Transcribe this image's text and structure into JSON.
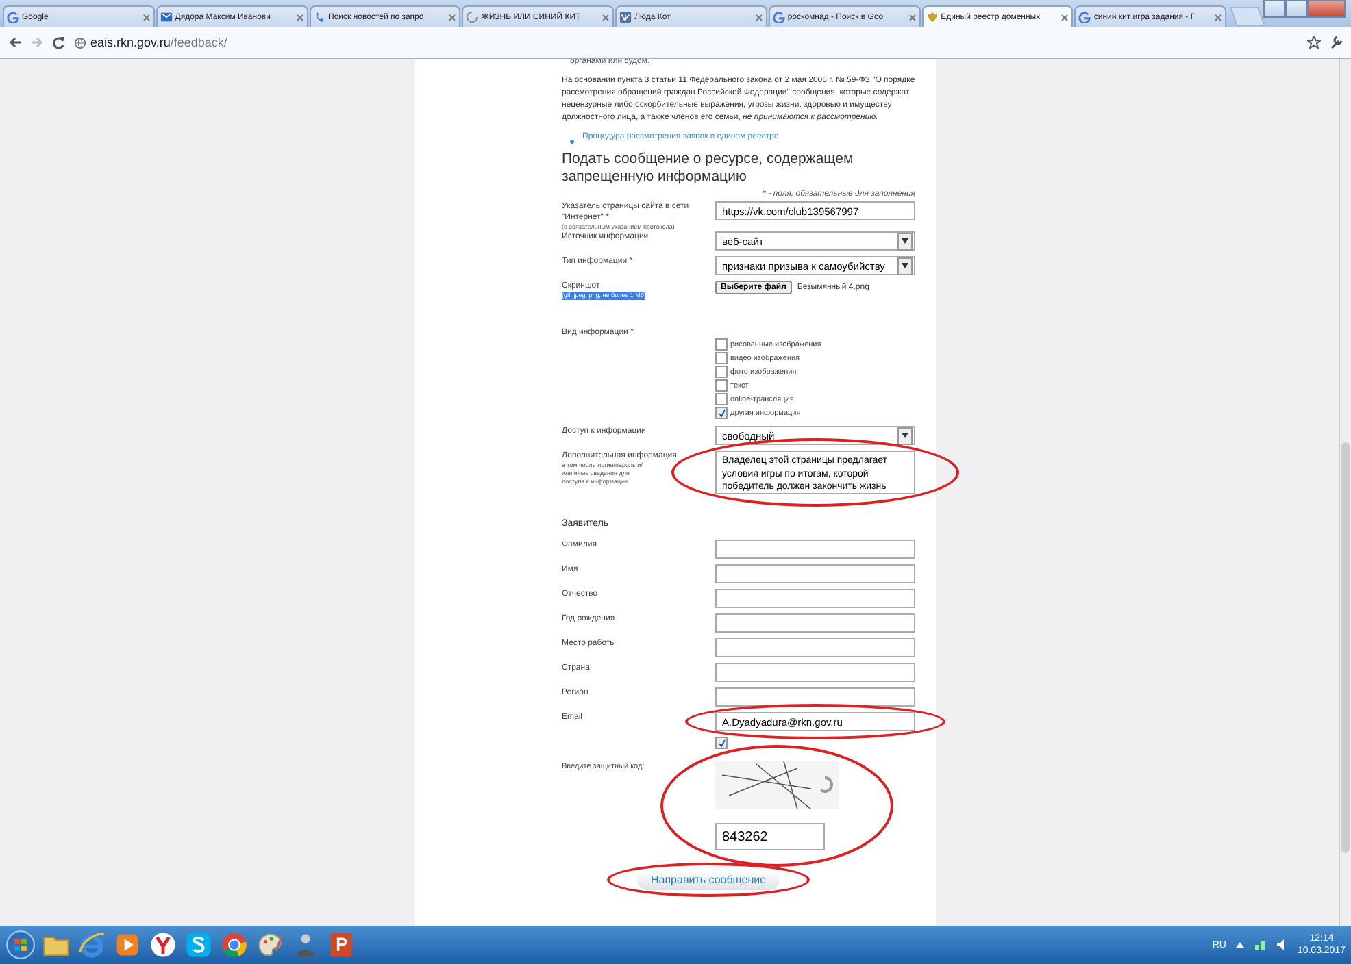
{
  "browser": {
    "tabs": [
      {
        "title": "Google",
        "kind": "google",
        "selected": false
      },
      {
        "title": "Дядора Максим Иванови",
        "kind": "mail",
        "selected": false
      },
      {
        "title": "Поиск новостей по запро",
        "kind": "search",
        "selected": false
      },
      {
        "title": "ЖИЗНЬ ИЛИ СИНИЙ КИТ",
        "kind": "loading",
        "selected": false
      },
      {
        "title": "Люда Кот",
        "kind": "vk",
        "selected": false
      },
      {
        "title": "роскомнад - Поиск в Goo",
        "kind": "google",
        "selected": false
      },
      {
        "title": "Единый реестр доменных",
        "kind": "emblem",
        "selected": true
      },
      {
        "title": "синий кит игра задания - Г",
        "kind": "google",
        "selected": false
      }
    ],
    "address": {
      "host": "eais.rkn.gov.ru",
      "path": "/feedback/"
    }
  },
  "page": {
    "cut_text": "органами или судом.",
    "notice": "На основании пункта 3 статьи 11 Федерального закона от 2 мая 2006 г. № 59-ФЗ \"О порядке рассмотрения обращений граждан Российской Федерации\" сообщения, которые содержат нецензурные либо оскорбительные выражения, угрозы жизни, здоровью и имуществу должностного лица, а также членов его семьи, *не принимаются к рассмотрению.*",
    "link": "Процедура рассмотрения заявок в едином реестре",
    "heading": "Подать сообщение о ресурсе, содержащем запрещенную информацию",
    "required_note": "* - поля, обязательные для заполнения",
    "fields": [
      {
        "kind": "text",
        "label": "Указатель страницы сайта в сети \"Интернет\" *",
        "hint": "(с обязательным указанием протокола)",
        "value": "https://vk.com/club139567997"
      },
      {
        "kind": "select",
        "label": "Источник информации",
        "value": "веб-сайт"
      },
      {
        "kind": "select",
        "label": "Тип информации *",
        "value": "признаки призыва к самоубийству"
      },
      {
        "kind": "file",
        "label": "Скриншот",
        "hint": "(gif, jpeg, png, не более 1 Мб)",
        "button": "Выберите файл",
        "value": "Безымянный 4.png"
      },
      {
        "kind": "checkboxes",
        "label": "Вид информации *",
        "options": [
          {
            "label": "рисованные изображения",
            "checked": false
          },
          {
            "label": "видео изображения",
            "checked": false
          },
          {
            "label": "фото изображения",
            "checked": false
          },
          {
            "label": "текст",
            "checked": false
          },
          {
            "label": "online-трансляция",
            "checked": false
          },
          {
            "label": "другая информация",
            "checked": true
          }
        ]
      },
      {
        "kind": "select",
        "label": "Доступ к информации",
        "value": "свободный"
      },
      {
        "kind": "textarea",
        "label": "Дополнительная информация",
        "hint": "в том числе логин/пароль и/или иные сведения для доступа к информации",
        "value": "Владелец этой страницы предлагает условия игры по итогам, которой победитель должен закончить жизнь"
      },
      {
        "kind": "section",
        "label": "Заявитель"
      },
      {
        "kind": "text",
        "label": "Фамилия"
      },
      {
        "kind": "text",
        "label": "Имя"
      },
      {
        "kind": "text",
        "label": "Отчество"
      },
      {
        "kind": "text",
        "label": "Год рождения"
      },
      {
        "kind": "text",
        "label": "Место работы"
      },
      {
        "kind": "text",
        "label": "Страна"
      },
      {
        "kind": "text",
        "label": "Регион"
      },
      {
        "kind": "text",
        "label": "Email",
        "value": "A.Dyadyadura@rkn.gov.ru"
      },
      {
        "kind": "checkbox",
        "checked": true
      },
      {
        "kind": "captcha",
        "label": "Введите защитный код:",
        "value": "843262"
      }
    ],
    "submit": "Направить сообщение"
  },
  "taskbar": {
    "apps": [
      {
        "kind": "start"
      },
      {
        "kind": "folder"
      },
      {
        "kind": "ie"
      },
      {
        "kind": "media"
      },
      {
        "kind": "yandex"
      },
      {
        "kind": "skype"
      },
      {
        "kind": "chrome"
      },
      {
        "kind": "paint"
      },
      {
        "kind": "person"
      },
      {
        "kind": "powerpoint"
      }
    ],
    "language": "RU",
    "time": "12:14",
    "date": "10.03.2017"
  }
}
